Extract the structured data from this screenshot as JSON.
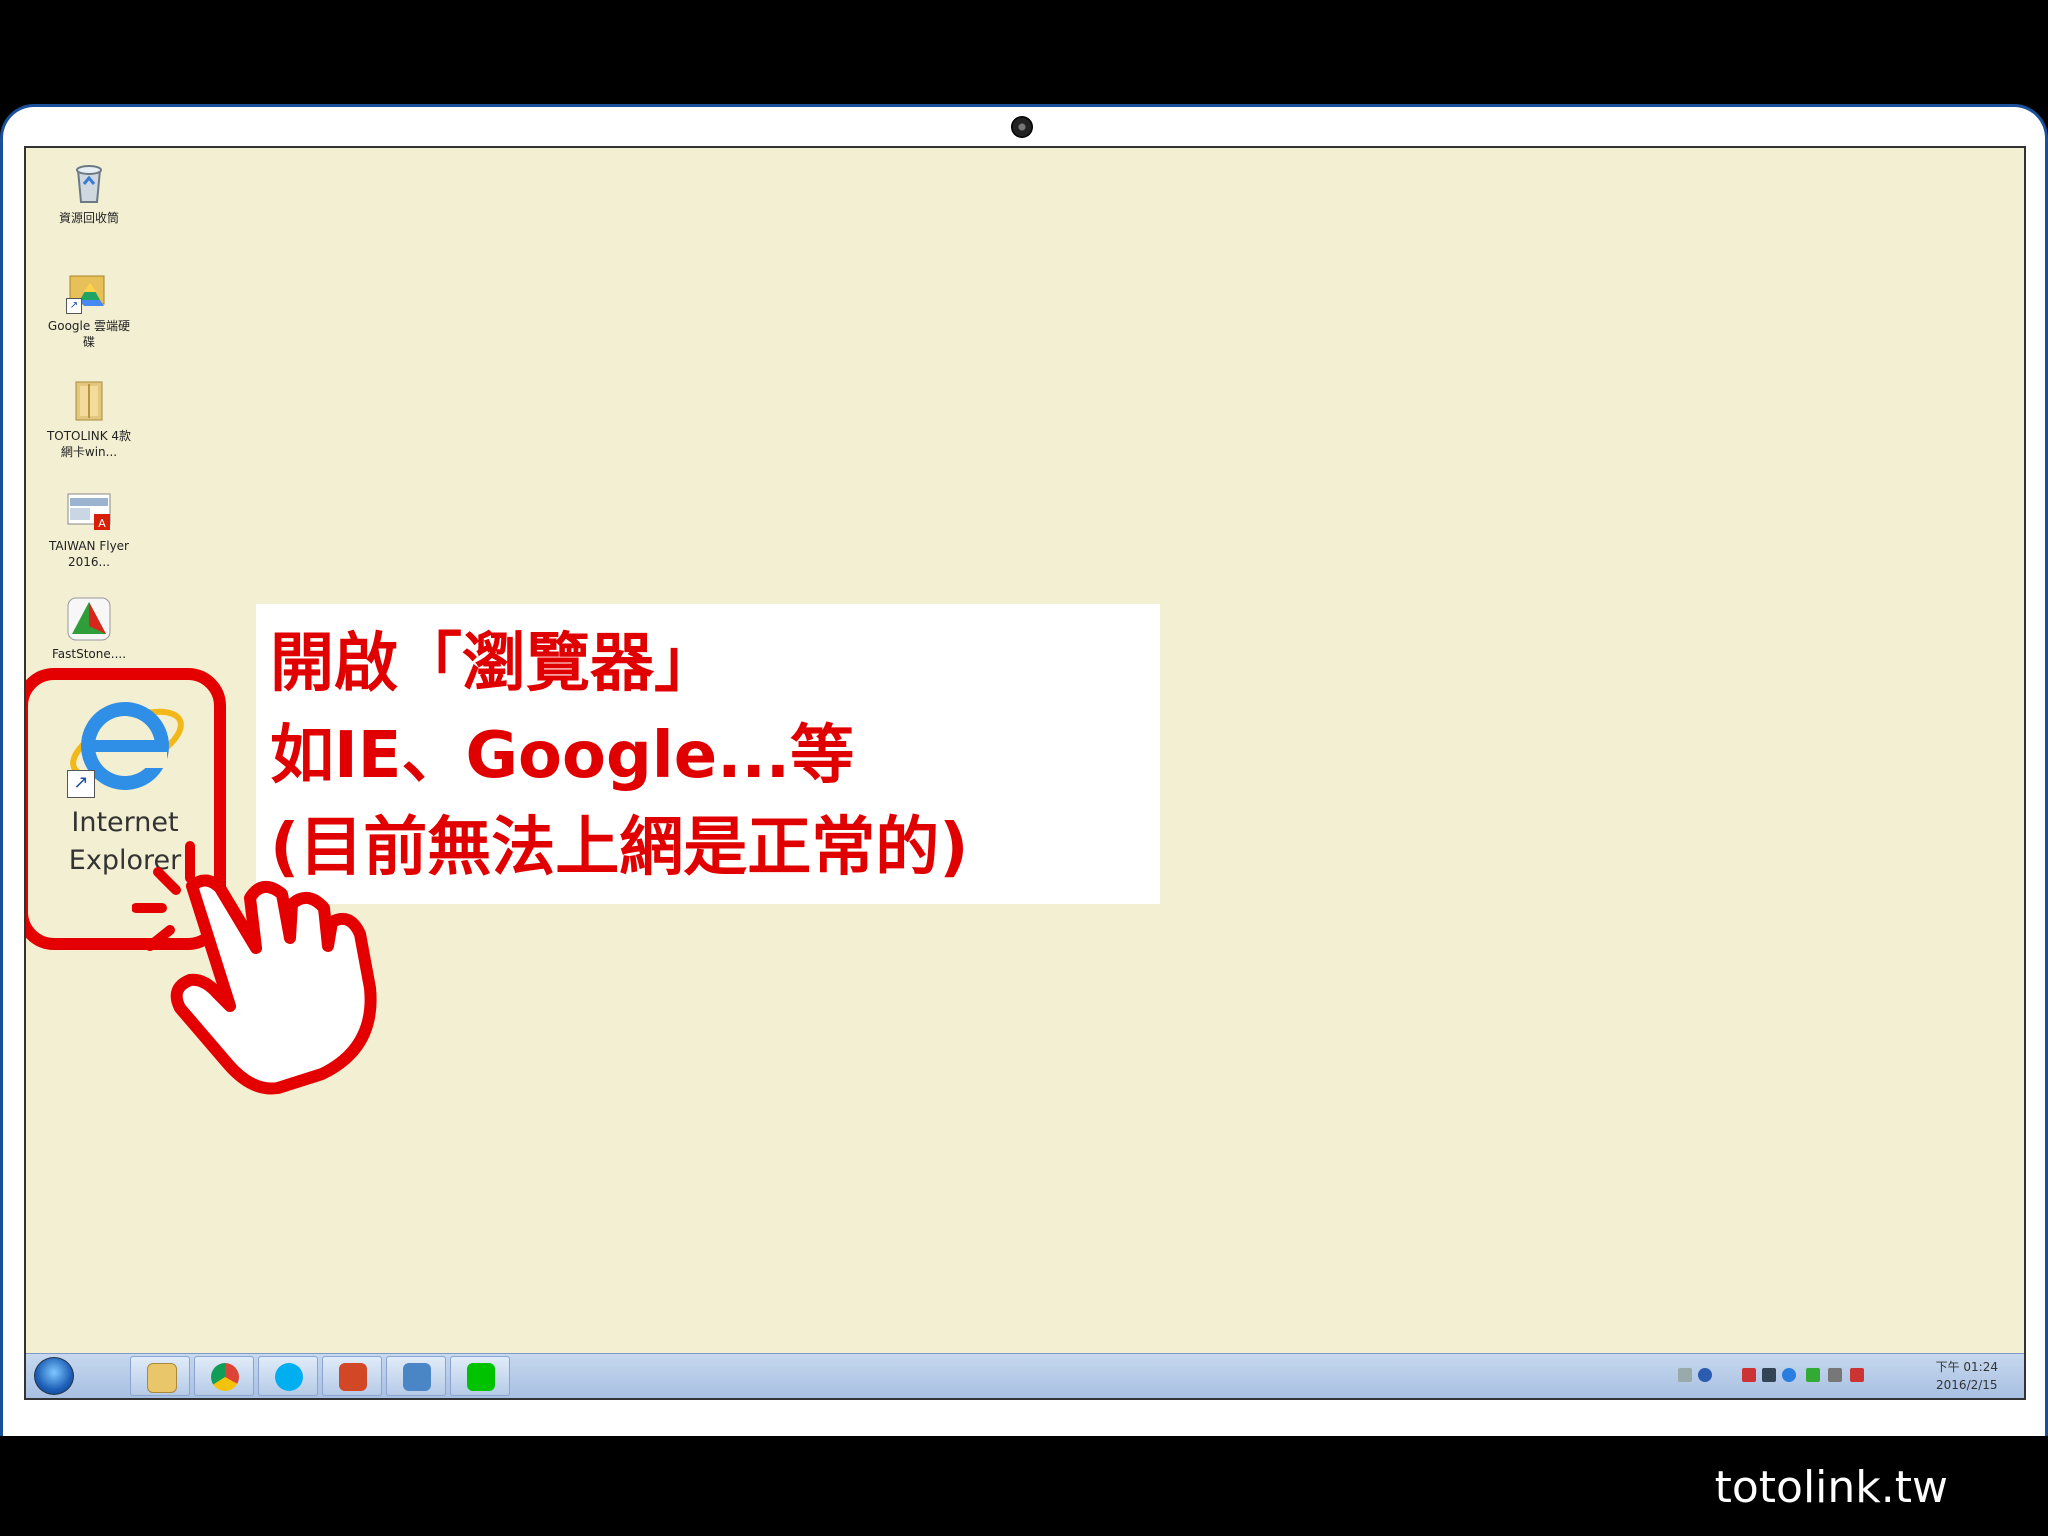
{
  "desktop": {
    "icons": [
      {
        "label": "資源回收筒",
        "icon": "recycle-bin-icon"
      },
      {
        "label": "Google 雲端硬碟",
        "icon": "google-drive-icon"
      },
      {
        "label": "TOTOLINK 4款網卡win...",
        "icon": "folder-icon"
      },
      {
        "label": "TAIWAN Flyer 2016...",
        "icon": "pdf-icon"
      },
      {
        "label": "FastStone....",
        "icon": "faststone-icon"
      }
    ],
    "ie_icon": {
      "label_line1": "Internet",
      "label_line2": "Explorer",
      "icon": "internet-explorer-icon"
    }
  },
  "callout": {
    "line1": "開啟「瀏覽器」",
    "line2": "如IE、Google...等",
    "line3": "(目前無法上網是正常的)",
    "color": "#e00000"
  },
  "taskbar": {
    "apps": [
      "file-explorer-icon",
      "chrome-icon",
      "skype-icon",
      "powerpoint-icon",
      "remote-desktop-icon",
      "line-icon"
    ],
    "clock_time": "下午 01:24",
    "clock_date": "2016/2/15"
  },
  "brand": "totolink.tw",
  "colors": {
    "accent": "#e40000",
    "desktop_bg": "#f2efd2",
    "taskbar": "#b6cbe8"
  }
}
